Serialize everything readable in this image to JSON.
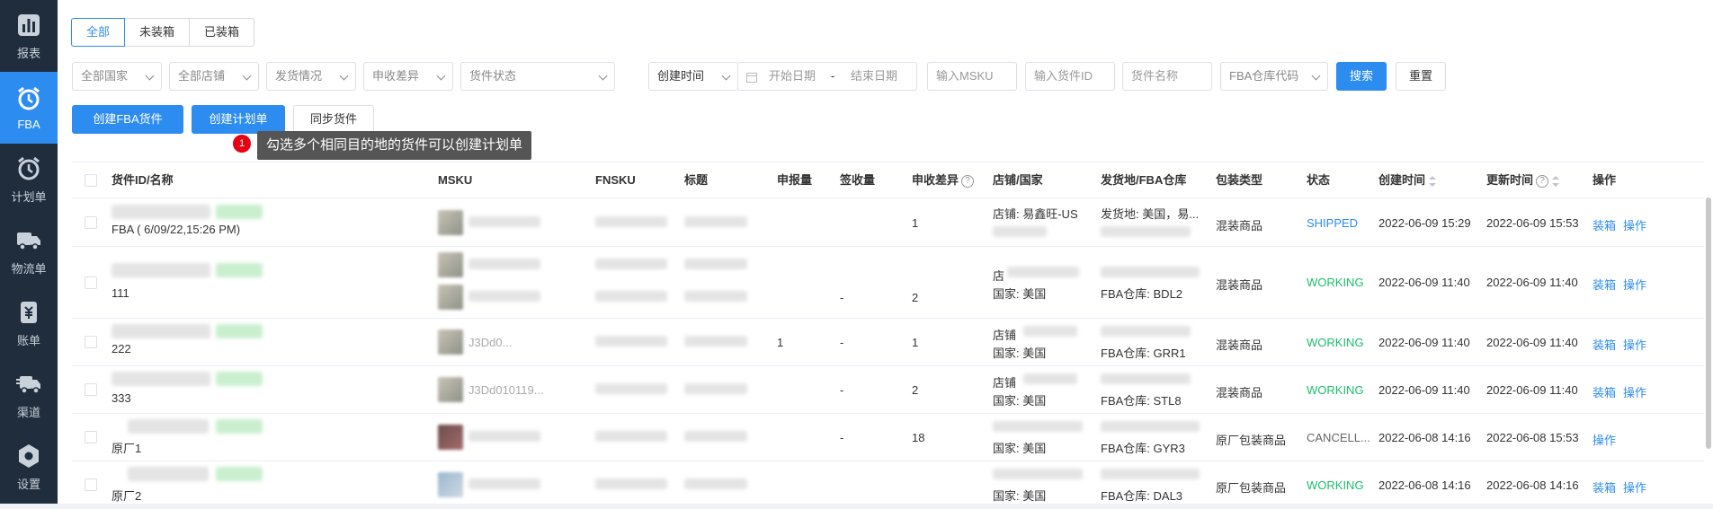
{
  "sidebar": {
    "items": [
      {
        "label": "报表",
        "icon": "chart-icon"
      },
      {
        "label": "FBA",
        "icon": "alarm-clock-icon",
        "active": true
      },
      {
        "label": "计划单",
        "icon": "alarm-clock-icon"
      },
      {
        "label": "物流单",
        "icon": "truck-icon"
      },
      {
        "label": "账单",
        "icon": "bill-icon"
      },
      {
        "label": "渠道",
        "icon": "truck-fast-icon"
      },
      {
        "label": "设置",
        "icon": "gear-icon"
      }
    ]
  },
  "tabs": [
    "全部",
    "未装箱",
    "已装箱"
  ],
  "filters": {
    "country": "全部国家",
    "store": "全部店铺",
    "ship_status": "发货情况",
    "diff": "申收差异",
    "shipment_status": "货件状态",
    "time_type": "创建时间",
    "start_date": "开始日期",
    "date_sep": "-",
    "end_date": "结束日期",
    "msku": "输入MSKU",
    "shipment_id": "输入货件ID",
    "shipment_name": "货件名称",
    "fba_code": "FBA仓库代码",
    "search": "搜索",
    "reset": "重置"
  },
  "actions": {
    "create_fba": "创建FBA货件",
    "create_plan": "创建计划单",
    "sync": "同步货件"
  },
  "tooltip": {
    "badge": "1",
    "text": "勾选多个相同目的地的货件可以创建计划单"
  },
  "columns": [
    "货件ID/名称",
    "MSKU",
    "FNSKU",
    "标题",
    "申报量",
    "签收量",
    "申收差异",
    "店铺/国家",
    "发货地/FBA仓库",
    "包装类型",
    "状态",
    "创建时间",
    "更新时间",
    "操作"
  ],
  "rows": [
    {
      "name": "FBA ( 6/09/22,15:26 PM)",
      "msku": "",
      "declared": "",
      "received": "",
      "diff": "1",
      "store": "店铺: 易鑫旺-US",
      "country": "",
      "origin": "发货地: 美国，易...",
      "fba": "",
      "pack": "混装商品",
      "status": "SHIPPED",
      "status_class": "st-ship",
      "created": "2022-06-09 15:29",
      "updated": "2022-06-09 15:53",
      "ops": [
        "装箱",
        "操作"
      ]
    },
    {
      "name": "111",
      "msku": "",
      "declared": "",
      "received": "-",
      "diff": "2",
      "store": "店",
      "country": "国家: 美国",
      "origin": "",
      "fba": "FBA仓库: BDL2",
      "pack": "混装商品",
      "status": "WORKING",
      "status_class": "st-work",
      "created": "2022-06-09 11:40",
      "updated": "2022-06-09 11:40",
      "ops": [
        "装箱",
        "操作"
      ]
    },
    {
      "name": "222",
      "msku": "J3Dd0...",
      "declared": "1",
      "received": "-",
      "diff": "1",
      "store": "店铺",
      "country": "国家: 美国",
      "origin": "",
      "fba": "FBA仓库: GRR1",
      "pack": "混装商品",
      "status": "WORKING",
      "status_class": "st-work",
      "created": "2022-06-09 11:40",
      "updated": "2022-06-09 11:40",
      "ops": [
        "装箱",
        "操作"
      ]
    },
    {
      "name": "333",
      "msku": "J3Dd010119...",
      "declared": "",
      "received": "-",
      "diff": "2",
      "store": "店铺",
      "country": "国家: 美国",
      "origin": "",
      "fba": "FBA仓库: STL8",
      "pack": "混装商品",
      "status": "WORKING",
      "status_class": "st-work",
      "created": "2022-06-09 11:40",
      "updated": "2022-06-09 11:40",
      "ops": [
        "装箱",
        "操作"
      ]
    },
    {
      "name": "原厂1",
      "msku": "",
      "declared": "",
      "received": "-",
      "diff": "18",
      "store": "",
      "country": "国家: 美国",
      "origin": "",
      "fba": "FBA仓库: GYR3",
      "pack": "原厂包装商品",
      "status": "CANCELL...",
      "status_class": "st-cancel",
      "created": "2022-06-08 14:16",
      "updated": "2022-06-08 15:53",
      "ops": [
        "操作"
      ]
    },
    {
      "name": "原厂2",
      "msku": "",
      "declared": "",
      "received": "",
      "diff": "",
      "store": "",
      "country": "国家: 美国",
      "origin": "",
      "fba": "FBA仓库: DAL3",
      "pack": "原厂包装商品",
      "status": "WORKING",
      "status_class": "st-work",
      "created": "2022-06-08 14:16",
      "updated": "2022-06-08 14:16",
      "ops": [
        "装箱",
        "操作"
      ]
    }
  ]
}
